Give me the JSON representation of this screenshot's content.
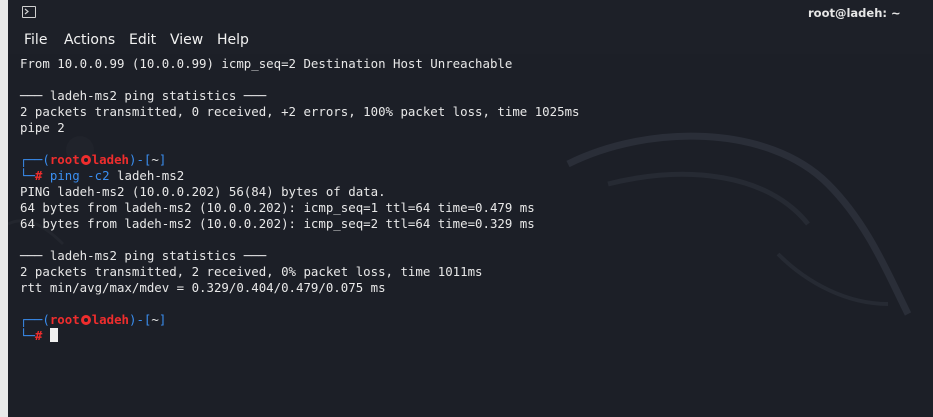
{
  "window": {
    "title": "root@ladeh: ~"
  },
  "menu": {
    "items": [
      "File",
      "Actions",
      "Edit",
      "View",
      "Help"
    ]
  },
  "terminal": {
    "lines": [
      "From 10.0.0.99 (10.0.0.99) icmp_seq=2 Destination Host Unreachable",
      "",
      "─── ladeh-ms2 ping statistics ───",
      "2 packets transmitted, 0 received, +2 errors, 100% packet loss, time 1025ms",
      "pipe 2"
    ],
    "prompt1": {
      "open": "┌──(",
      "user": "root",
      "host": "ladeh",
      "mid": ")-[",
      "path": "~",
      "close": "]",
      "hash_prefix": "└─",
      "hash": "#",
      "command": "ping",
      "option": "-c2",
      "arg": "ladeh-ms2"
    },
    "output2": [
      "PING ladeh-ms2 (10.0.0.202) 56(84) bytes of data.",
      "64 bytes from ladeh-ms2 (10.0.0.202): icmp_seq=1 ttl=64 time=0.479 ms",
      "64 bytes from ladeh-ms2 (10.0.0.202): icmp_seq=2 ttl=64 time=0.329 ms",
      "",
      "─── ladeh-ms2 ping statistics ───",
      "2 packets transmitted, 2 received, 0% packet loss, time 1011ms",
      "rtt min/avg/max/mdev = 0.329/0.404/0.479/0.075 ms"
    ],
    "prompt2": {
      "open": "┌──(",
      "user": "root",
      "host": "ladeh",
      "mid": ")-[",
      "path": "~",
      "close": "]",
      "hash_prefix": "└─",
      "hash": "#"
    }
  },
  "colors": {
    "background": "#1c1f27",
    "prompt_blue": "#3a8ef0",
    "prompt_red": "#ef2d2d",
    "text": "#e8e8e8"
  },
  "icons": [
    "terminal-icon",
    "kali-dragon-watermark",
    "skull-icon"
  ]
}
